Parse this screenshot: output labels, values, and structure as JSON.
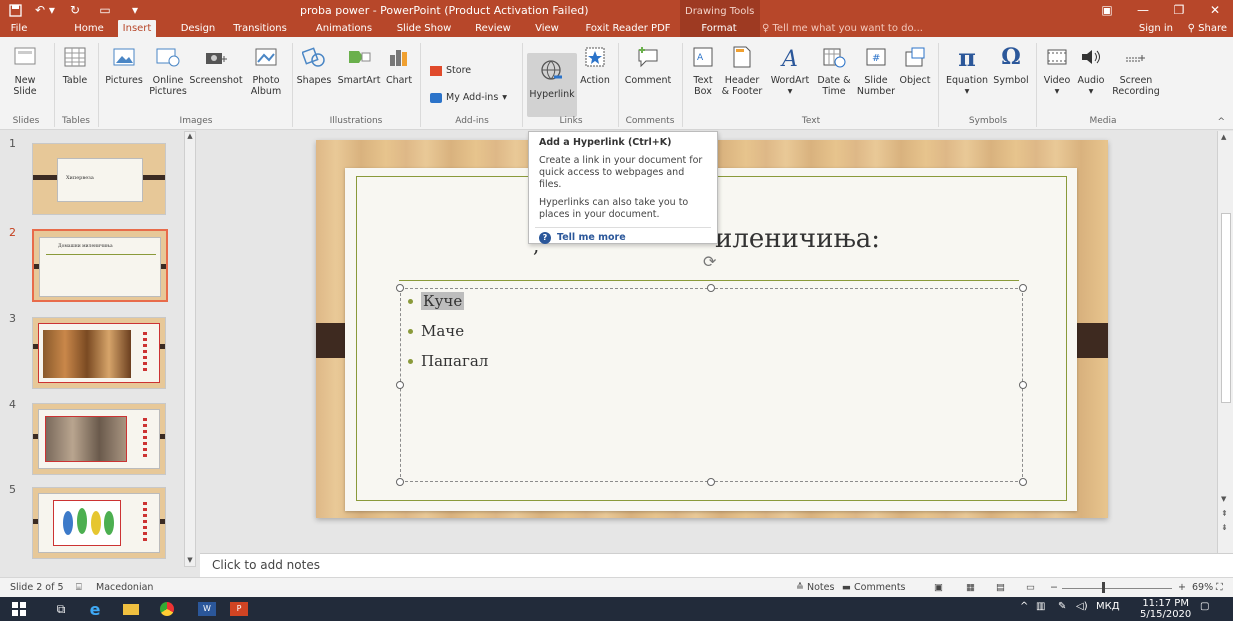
{
  "window": {
    "title": "proba power - PowerPoint (Product Activation Failed)",
    "contextual_group": "Drawing Tools",
    "sign_in": "Sign in",
    "share": "Share",
    "tell_me": "Tell me what you want to do..."
  },
  "tabs": [
    "File",
    "Home",
    "Insert",
    "Design",
    "Transitions",
    "Animations",
    "Slide Show",
    "Review",
    "View",
    "Foxit Reader PDF",
    "Format"
  ],
  "active_tab": "Insert",
  "ribbon": {
    "new_slide": "New Slide",
    "table": "Table",
    "pictures": "Pictures",
    "online_pictures": "Online Pictures",
    "screenshot": "Screenshot",
    "photo_album": "Photo Album",
    "shapes": "Shapes",
    "smartart": "SmartArt",
    "chart": "Chart",
    "store": "Store",
    "my_addins": "My Add-ins",
    "hyperlink": "Hyperlink",
    "action": "Action",
    "comment": "Comment",
    "text_box": "Text Box",
    "header_footer": "Header & Footer",
    "wordart": "WordArt",
    "date_time": "Date & Time",
    "slide_number": "Slide Number",
    "object": "Object",
    "equation": "Equation",
    "symbol": "Symbol",
    "video": "Video",
    "audio": "Audio",
    "screen_recording": "Screen Recording",
    "groups": {
      "slides": "Slides",
      "tables": "Tables",
      "images": "Images",
      "illustrations": "Illustrations",
      "addins": "Add-ins",
      "links": "Links",
      "comments": "Comments",
      "text": "Text",
      "symbols": "Symbols",
      "media": "Media"
    }
  },
  "tooltip": {
    "title": "Add a Hyperlink (Ctrl+K)",
    "line1": "Create a link in your document for quick access to webpages and files.",
    "line2": "Hyperlinks can also take you to places in your document.",
    "more": "Tell me more"
  },
  "thumbnails": [
    {
      "num": "1",
      "caption": "Хипервеза"
    },
    {
      "num": "2",
      "caption": "Домашни миленичиња"
    },
    {
      "num": "3",
      "caption": ""
    },
    {
      "num": "4",
      "caption": ""
    },
    {
      "num": "5",
      "caption": ""
    }
  ],
  "slide": {
    "title": "иленичиња:",
    "title_prefix": ",",
    "bullets": [
      "Куче",
      "Маче",
      "Папагал"
    ]
  },
  "notes_placeholder": "Click to add notes",
  "status": {
    "slide_of": "Slide 2 of 5",
    "language": "Macedonian",
    "notes": "Notes",
    "comments": "Comments",
    "zoom": "69%"
  },
  "taskbar": {
    "lang": "МКД",
    "time": "11:17 PM",
    "date": "5/15/2020"
  }
}
